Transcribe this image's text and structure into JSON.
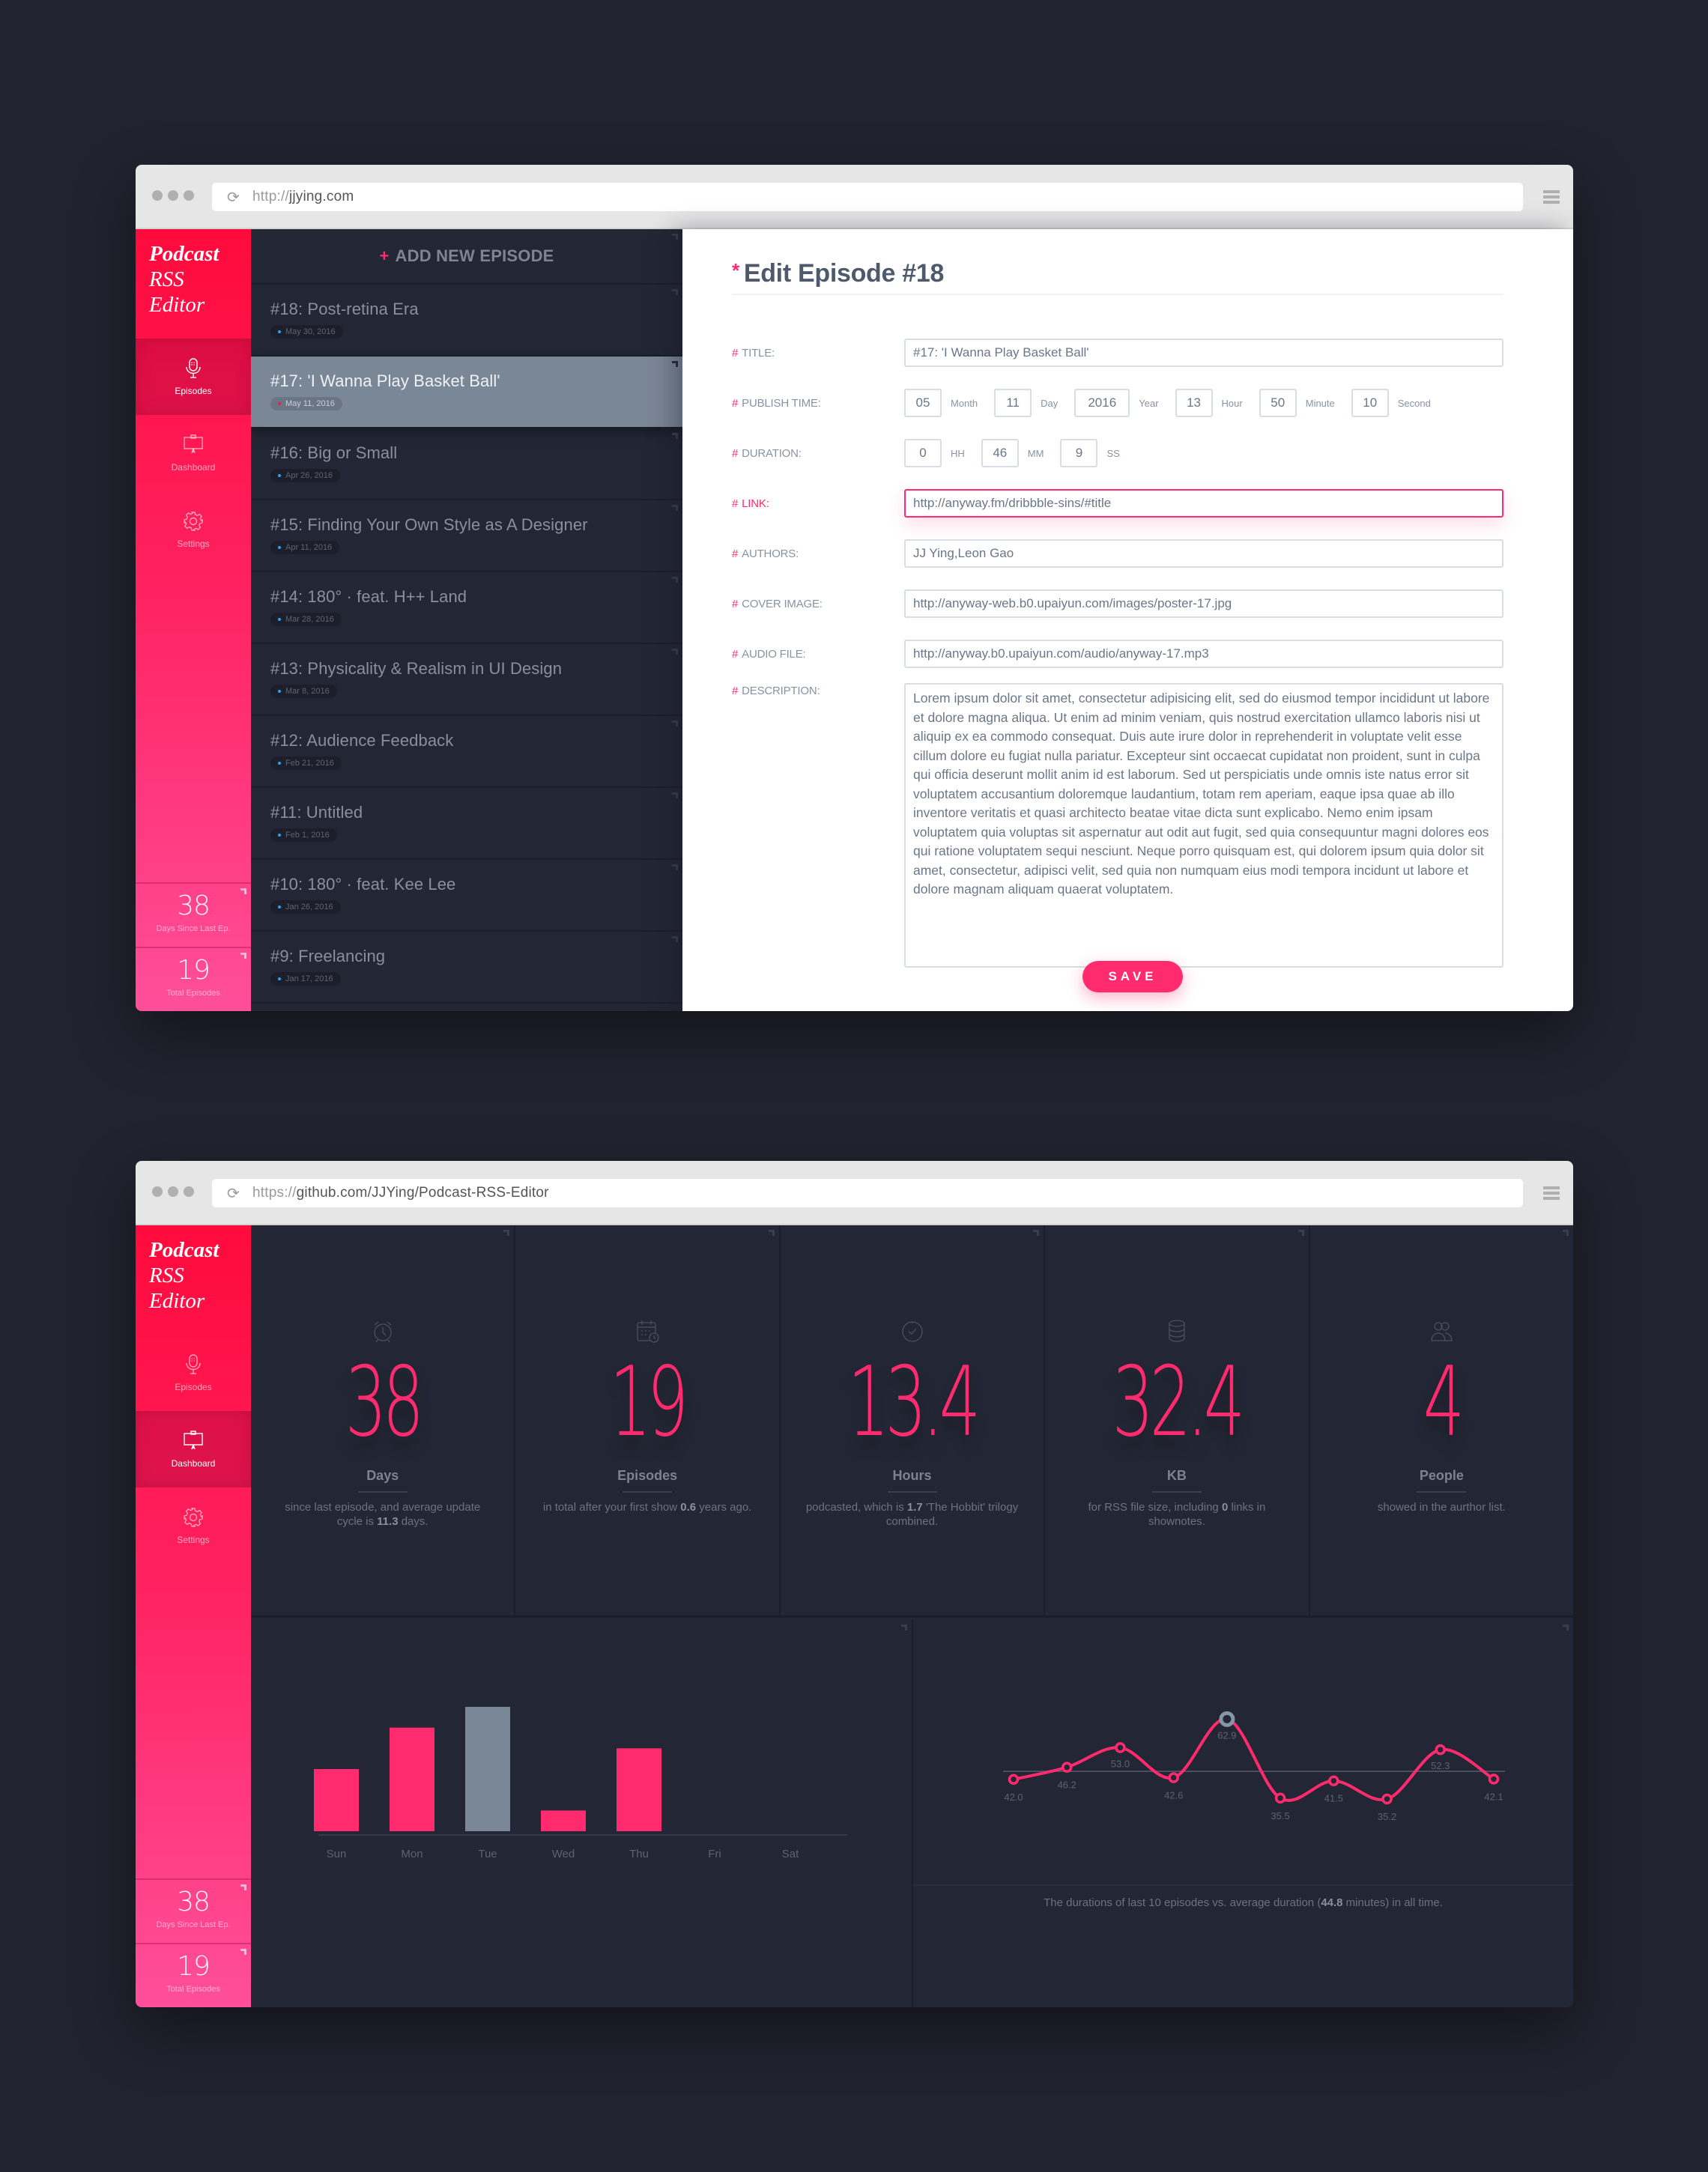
{
  "window1": {
    "url_proto": "http://",
    "url_host": "jjying.com",
    "app": {
      "logo": [
        "Podcast",
        "RSS",
        "Editor"
      ],
      "nav": [
        {
          "label": "Episodes",
          "icon": "microphone-icon",
          "active": true
        },
        {
          "label": "Dashboard",
          "icon": "presentation-board-icon",
          "active": false
        },
        {
          "label": "Settings",
          "icon": "gear-icon",
          "active": false
        }
      ],
      "side_stats": [
        {
          "value": "38",
          "label": "Days Since Last Ep."
        },
        {
          "value": "19",
          "label": "Total Episodes"
        }
      ]
    },
    "episode_list": {
      "add_label": "ADD NEW EPISODE",
      "add_icon": "+",
      "items": [
        {
          "title": "#18: Post-retina Era",
          "date": "May 30, 2016",
          "selected": false
        },
        {
          "title": "#17: 'I Wanna Play Basket Ball'",
          "date": "May 11, 2016",
          "selected": true
        },
        {
          "title": "#16: Big or Small",
          "date": "Apr 26, 2016",
          "selected": false
        },
        {
          "title": "#15: Finding Your Own Style as A Designer",
          "date": "Apr 11, 2016",
          "selected": false
        },
        {
          "title": "#14: 180° · feat. H++ Land",
          "date": "Mar 28, 2016",
          "selected": false
        },
        {
          "title": "#13: Physicality & Realism in UI Design",
          "date": "Mar 8, 2016",
          "selected": false
        },
        {
          "title": "#12: Audience Feedback",
          "date": "Feb 21, 2016",
          "selected": false
        },
        {
          "title": "#11: Untitled",
          "date": "Feb 1, 2016",
          "selected": false
        },
        {
          "title": "#10: 180° · feat. Kee Lee",
          "date": "Jan 26, 2016",
          "selected": false
        },
        {
          "title": "#9: Freelancing",
          "date": "Jan 17, 2016",
          "selected": false
        }
      ]
    },
    "editor": {
      "title_marker": "*",
      "title": "Edit Episode #18",
      "label_marker": "#",
      "fields": {
        "title": {
          "label": "TITLE:",
          "value": "#17: 'I Wanna Play Basket Ball'"
        },
        "publish_time": {
          "label": "PUBLISH TIME:",
          "parts": [
            {
              "value": "05",
              "unit": "Month"
            },
            {
              "value": "11",
              "unit": "Day"
            },
            {
              "value": "2016",
              "unit": "Year"
            },
            {
              "value": "13",
              "unit": "Hour"
            },
            {
              "value": "50",
              "unit": "Minute"
            },
            {
              "value": "10",
              "unit": "Second"
            }
          ]
        },
        "duration": {
          "label": "DURATION:",
          "parts": [
            {
              "value": "0",
              "unit": "HH"
            },
            {
              "value": "46",
              "unit": "MM"
            },
            {
              "value": "9",
              "unit": "SS"
            }
          ]
        },
        "link": {
          "label": "LINK:",
          "value": "http://anyway.fm/dribbble-sins/#title",
          "focused": true
        },
        "authors": {
          "label": "AUTHORS:",
          "value": "JJ Ying,Leon Gao"
        },
        "cover_image": {
          "label": "COVER IMAGE:",
          "value": "http://anyway-web.b0.upaiyun.com/images/poster-17.jpg"
        },
        "audio_file": {
          "label": "AUDIO FILE:",
          "value": "http://anyway.b0.upaiyun.com/audio/anyway-17.mp3"
        },
        "description": {
          "label": "DESCRIPTION:",
          "value": "Lorem ipsum dolor sit amet, consectetur adipisicing elit, sed do eiusmod tempor incididunt ut labore et dolore magna aliqua. Ut enim ad minim veniam, quis nostrud exercitation ullamco laboris nisi ut aliquip ex ea commodo consequat. Duis aute irure dolor in reprehenderit in voluptate velit esse cillum dolore eu fugiat nulla pariatur. Excepteur sint occaecat cupidatat non proident, sunt in culpa qui officia deserunt mollit anim id est laborum. Sed ut perspiciatis unde omnis iste natus error sit voluptatem accusantium doloremque laudantium, totam rem aperiam, eaque ipsa quae ab illo inventore veritatis et quasi architecto beatae vitae dicta sunt explicabo. Nemo enim ipsam voluptatem quia voluptas sit aspernatur aut odit aut fugit, sed quia consequuntur magni dolores eos qui ratione voluptatem sequi nesciunt. Neque porro quisquam est, qui dolorem ipsum quia dolor sit amet, consectetur, adipisci velit, sed quia non numquam eius modi tempora incidunt ut labore et dolore magnam aliquam quaerat voluptatem."
        }
      },
      "save_label": "SAVE"
    }
  },
  "window2": {
    "url_proto": "https://",
    "url_host": "github.com/JJYing/Podcast-RSS-Editor",
    "app": {
      "logo": [
        "Podcast",
        "RSS",
        "Editor"
      ],
      "nav": [
        {
          "label": "Episodes",
          "icon": "microphone-icon",
          "active": false
        },
        {
          "label": "Dashboard",
          "icon": "presentation-board-icon",
          "active": true
        },
        {
          "label": "Settings",
          "icon": "gear-icon",
          "active": false
        }
      ],
      "side_stats": [
        {
          "value": "38",
          "label": "Days Since Last Ep."
        },
        {
          "value": "19",
          "label": "Total Episodes"
        }
      ]
    },
    "stats": [
      {
        "icon": "alarm-clock-icon",
        "value": "38",
        "unit": "Days",
        "desc_pre": "since last episode, and average update cycle is ",
        "desc_bold": "11.3",
        "desc_post": " days."
      },
      {
        "icon": "calendar-clock-icon",
        "value": "19",
        "unit": "Episodes",
        "desc_pre": "in total after your first show ",
        "desc_bold": "0.6",
        "desc_post": " years ago."
      },
      {
        "icon": "clock-check-icon",
        "value": "13.4",
        "unit": "Hours",
        "desc_pre": "podcasted, which is ",
        "desc_bold": "1.7",
        "desc_post": " 'The Hobbit' trilogy combined."
      },
      {
        "icon": "database-icon",
        "value": "32.4",
        "unit": "KB",
        "desc_pre": "for RSS file size, including ",
        "desc_bold": "0",
        "desc_post": " links in shownotes."
      },
      {
        "icon": "people-icon",
        "value": "4",
        "unit": "People",
        "desc_pre": "showed in the aurthor list.",
        "desc_bold": "",
        "desc_post": ""
      }
    ],
    "line_caption": {
      "pre": "The durations of last 10 episodes vs. average duration (",
      "bold": "44.8",
      "post": " minutes) in all time."
    }
  },
  "colors": {
    "accent": "#ff2b6e",
    "highlight_gray": "#7a8797",
    "panel_bg": "#232634",
    "page_bg": "#22232f"
  },
  "chart_data": [
    {
      "type": "bar",
      "title": "",
      "categories": [
        "Sun",
        "Mon",
        "Tue",
        "Wed",
        "Thu",
        "Fri",
        "Sat"
      ],
      "values": [
        3,
        5,
        6,
        1,
        4,
        0,
        0
      ],
      "highlight_index": 2,
      "xlabel": "",
      "ylabel": "",
      "ylim": [
        0,
        6
      ],
      "grid": false,
      "legend": "none"
    },
    {
      "type": "line",
      "title": "",
      "x": [
        1,
        2,
        3,
        4,
        5,
        6,
        7,
        8,
        9,
        10
      ],
      "values": [
        42.0,
        46.2,
        53.0,
        42.6,
        62.9,
        35.5,
        41.5,
        35.2,
        52.3,
        42.1
      ],
      "labels": [
        "42.0",
        "46.2",
        "53.0",
        "42.6",
        "62.9",
        "35.5",
        "41.5",
        "35.2",
        "52.3",
        "42.1"
      ],
      "reference_line": 44.8,
      "highlight_index": 4,
      "ylim": [
        30,
        66
      ],
      "grid": false,
      "legend": "none"
    }
  ]
}
